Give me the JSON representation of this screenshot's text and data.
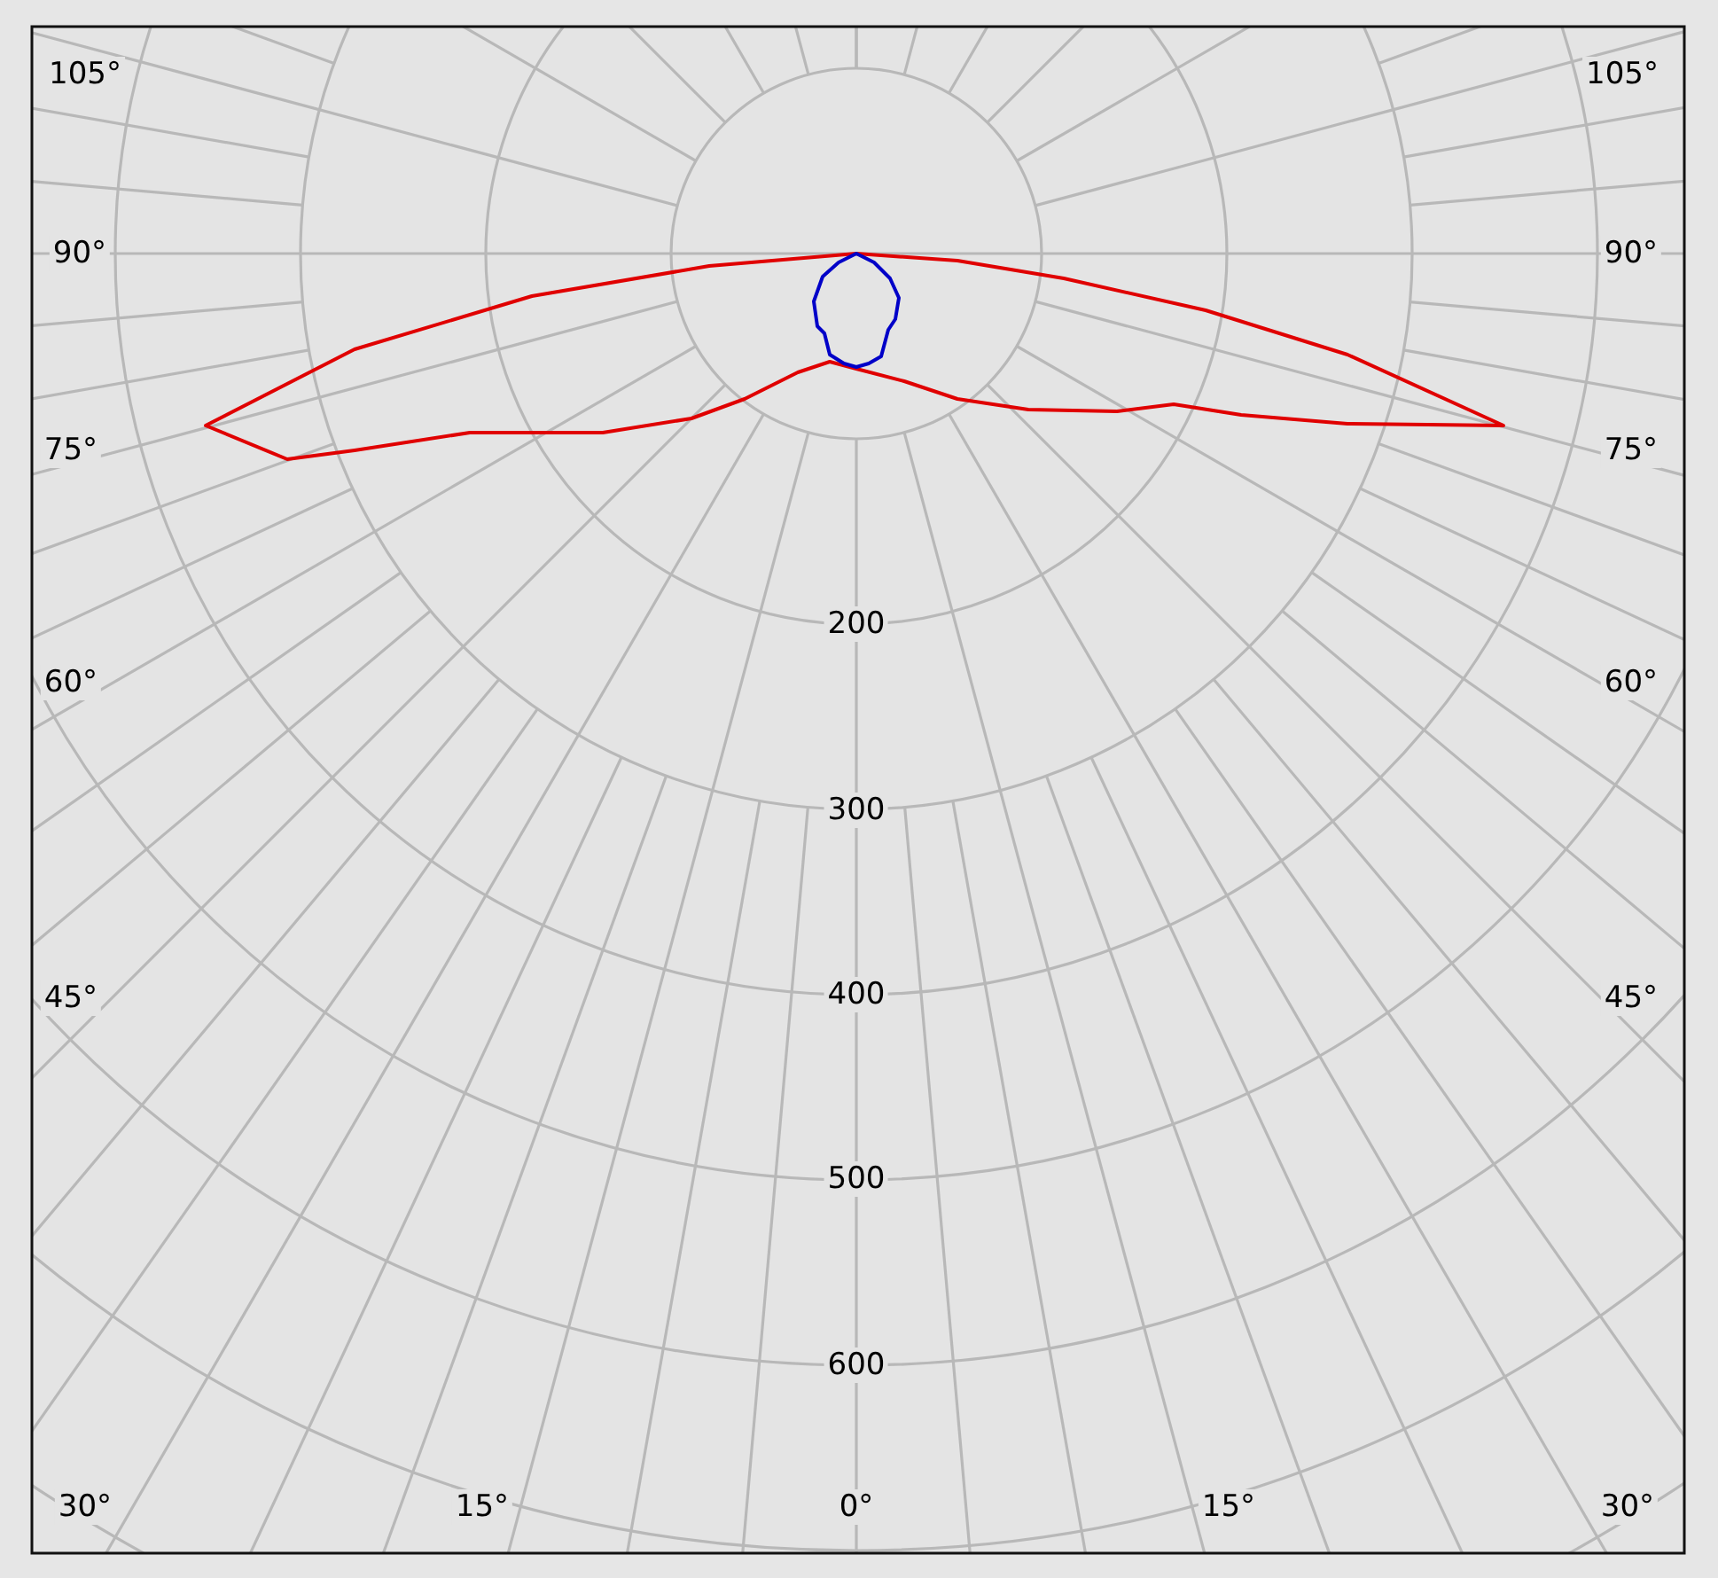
{
  "diagram": {
    "angle_labels_left": [
      "105°",
      "90°",
      "75°",
      "60°",
      "45°"
    ],
    "angle_labels_right": [
      "105°",
      "90°",
      "75°",
      "60°",
      "45°"
    ],
    "angle_labels_bottom": [
      "30°",
      "15°",
      "0°",
      "15°",
      "30°"
    ],
    "radial_labels": [
      "200",
      "300",
      "400",
      "500",
      "600"
    ],
    "curves": [
      {
        "kind": "wide",
        "color": "#e00000"
      },
      {
        "kind": "narrow",
        "color": "#0000c8"
      }
    ]
  }
}
